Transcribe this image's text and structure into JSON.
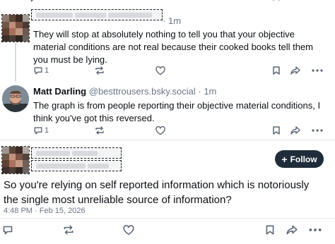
{
  "posts": [
    {
      "author_name": "",
      "handle": "",
      "time": "1m",
      "text": "They will stop at absolutely nothing to tell you that your objective material conditions are not real because their cooked books tell them you must be lying.",
      "reply_count": "1"
    },
    {
      "author_name": "Matt Darling",
      "handle": "@besttrousers.bsky.social",
      "time": "1m",
      "text": "The graph is from people reporting their objective material conditions, I think you've got this reversed.",
      "reply_count": "1"
    }
  ],
  "focused_post": {
    "text": "So you're relying on self reported information which is notoriously the single most unreliable source of information?",
    "timestamp": "4:48 PM · Feb 15, 2026",
    "follow_label": "Follow"
  },
  "meta_separator": "·",
  "icons": [
    "reply-icon",
    "repost-icon",
    "like-icon",
    "bookmark-icon",
    "share-icon",
    "more-icon",
    "follow-plus-icon"
  ],
  "colors": {
    "text": "#0b0f14",
    "muted": "#6b7685",
    "icon": "#5a6675",
    "follow_button": "#1f2d3a",
    "thread_line": "#d4dbe2"
  }
}
